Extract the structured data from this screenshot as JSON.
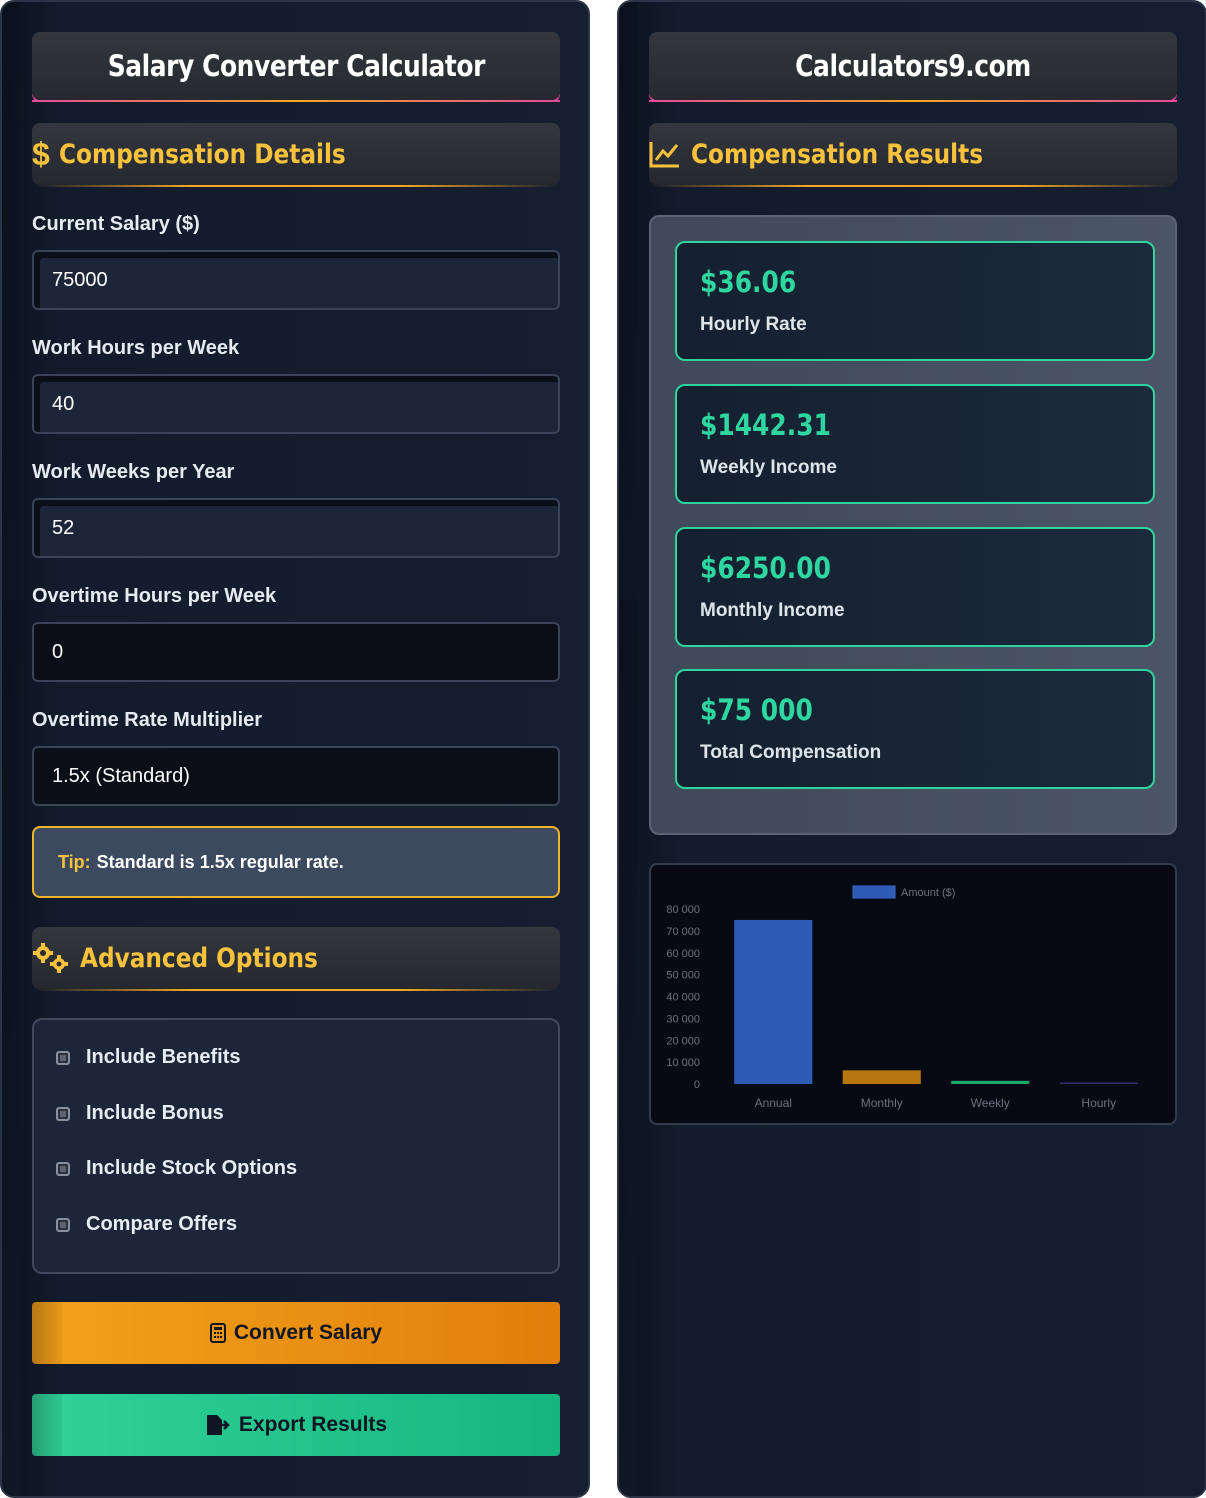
{
  "left": {
    "title": "Salary Converter Calculator",
    "section_compensation": "Compensation Details",
    "fields": {
      "current_salary": {
        "label": "Current Salary ($)",
        "value": "75000"
      },
      "hours_per_week": {
        "label": "Work Hours per Week",
        "value": "40"
      },
      "weeks_per_year": {
        "label": "Work Weeks per Year",
        "value": "52"
      },
      "overtime_hours": {
        "label": "Overtime Hours per Week",
        "value": "0"
      },
      "overtime_multiplier": {
        "label": "Overtime Rate Multiplier",
        "value": "1.5x (Standard)"
      }
    },
    "tip": {
      "key": "Tip:",
      "text": "Standard is 1.5x regular rate."
    },
    "section_advanced": "Advanced Options",
    "options": [
      "Include Benefits",
      "Include Bonus",
      "Include Stock Options",
      "Compare Offers"
    ],
    "buttons": {
      "convert": "Convert Salary",
      "export": "Export Results"
    }
  },
  "right": {
    "title": "Calculators9.com",
    "section_results": "Compensation Results",
    "results": [
      {
        "value": "$36.06",
        "label": "Hourly Rate"
      },
      {
        "value": "$1442.31",
        "label": "Weekly Income"
      },
      {
        "value": "$6250.00",
        "label": "Monthly Income"
      },
      {
        "value": "$75 000",
        "label": "Total Compensation"
      }
    ]
  },
  "colors": {
    "accent_gold": "#f9c23c",
    "accent_green": "#2fd7a0",
    "accent_pink": "#e84a9b"
  },
  "chart_data": {
    "type": "bar",
    "categories": [
      "Annual",
      "Monthly",
      "Weekly",
      "Hourly"
    ],
    "series": [
      {
        "name": "Amount ($)",
        "values": [
          75000,
          6250,
          1442.31,
          36.06
        ]
      }
    ],
    "bar_colors": [
      "#2d5bb5",
      "#b8760f",
      "#18a86c",
      "#3a2a6e"
    ],
    "ylim": [
      0,
      80000
    ],
    "yticks": [
      "0",
      "10 000",
      "20 000",
      "30 000",
      "40 000",
      "50 000",
      "60 000",
      "70 000",
      "80 000"
    ],
    "legend": "top"
  }
}
